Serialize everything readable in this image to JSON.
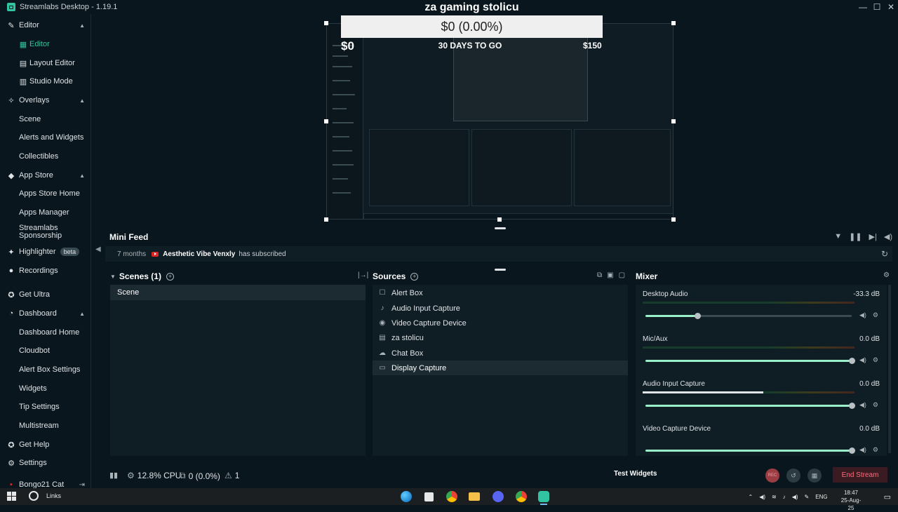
{
  "window": {
    "title": "Streamlabs Desktop - 1.19.1",
    "controls": [
      "—",
      "☐",
      "✕"
    ]
  },
  "sidebar": {
    "items": [
      {
        "label": "Editor",
        "icon": "pen-icon",
        "type": "section"
      },
      {
        "label": "Editor",
        "icon": "editor-icon",
        "type": "sub",
        "active": true
      },
      {
        "label": "Layout Editor",
        "icon": "layout-icon",
        "type": "sub"
      },
      {
        "label": "Studio Mode",
        "icon": "studio-mode-icon",
        "type": "sub"
      },
      {
        "label": "Overlays",
        "icon": "overlays-icon",
        "type": "section"
      },
      {
        "label": "Scene",
        "type": "plain"
      },
      {
        "label": "Alerts and Widgets",
        "type": "plain"
      },
      {
        "label": "Collectibles",
        "type": "plain"
      },
      {
        "label": "App Store",
        "icon": "store-icon",
        "type": "section"
      },
      {
        "label": "Apps Store Home",
        "type": "plain"
      },
      {
        "label": "Apps Manager",
        "type": "plain"
      },
      {
        "label": "Streamlabs Sponsorship",
        "type": "plain"
      },
      {
        "label": "Highlighter",
        "icon": "highlighter-icon",
        "type": "section",
        "badge": "beta"
      },
      {
        "label": "Recordings",
        "icon": "recordings-icon",
        "type": "section"
      },
      {
        "label": "Get Ultra",
        "icon": "ultra-icon",
        "type": "section"
      },
      {
        "label": "Dashboard",
        "icon": "dashboard-icon",
        "type": "section"
      },
      {
        "label": "Dashboard Home",
        "type": "plain"
      },
      {
        "label": "Cloudbot",
        "type": "plain"
      },
      {
        "label": "Alert Box Settings",
        "type": "plain"
      },
      {
        "label": "Widgets",
        "type": "plain"
      },
      {
        "label": "Tip Settings",
        "type": "plain"
      },
      {
        "label": "Multistream",
        "type": "plain"
      },
      {
        "label": "Get Help",
        "icon": "help-icon",
        "type": "section"
      },
      {
        "label": "Settings",
        "icon": "settings-icon",
        "type": "section"
      },
      {
        "label": "Bongo21 Cat",
        "icon": "bongo-icon",
        "type": "section"
      }
    ]
  },
  "preview": {
    "goal_title": "za gaming stolicu",
    "goal_progress": "$0 (0.00%)",
    "goal_start": "$0",
    "goal_days": "30 DAYS TO GO",
    "goal_target": "$150",
    "progress_fraction": 0.0
  },
  "minifeed": {
    "title": "Mini Feed",
    "event": {
      "time": "7 months",
      "platform": "youtube",
      "name": "Aesthetic Vibe Venxly",
      "action": "has subscribed"
    }
  },
  "scenes": {
    "title": "Scenes (1)",
    "items": [
      "Scene"
    ]
  },
  "sources": {
    "title": "Sources",
    "items": [
      {
        "label": "Alert Box",
        "icon": "alert-box-icon",
        "glyph": "☐"
      },
      {
        "label": "Audio Input Capture",
        "icon": "microphone-icon",
        "glyph": "♪"
      },
      {
        "label": "Video Capture Device",
        "icon": "camera-icon",
        "glyph": "◉"
      },
      {
        "label": "za stolicu",
        "icon": "goal-icon",
        "glyph": "▤"
      },
      {
        "label": "Chat Box",
        "icon": "chat-icon",
        "glyph": "☁"
      },
      {
        "label": "Display Capture",
        "icon": "monitor-icon",
        "glyph": "▭",
        "selected": true
      }
    ]
  },
  "mixer": {
    "title": "Mixer",
    "channels": [
      {
        "name": "Desktop Audio",
        "db": "-33.3 dB",
        "volume": 0.25,
        "meter": 0.0
      },
      {
        "name": "Mic/Aux",
        "db": "0.0 dB",
        "volume": 1.0,
        "meter": 0.0
      },
      {
        "name": "Audio Input Capture",
        "db": "0.0 dB",
        "volume": 1.0,
        "meter": 0.57
      },
      {
        "name": "Video Capture Device",
        "db": "0.0 dB",
        "volume": 1.0,
        "meter": 0.0
      }
    ]
  },
  "status": {
    "cpu": "12.8% CPU",
    "dropped": "0 (0.0%)",
    "alerts": "1",
    "test_widgets": "Test Widgets",
    "rec_label": "REC",
    "end_stream": "End Stream"
  },
  "taskbar": {
    "links": "Links",
    "language": "ENG",
    "time": "18:47",
    "date": "25-Aug-25"
  },
  "colors": {
    "accent": "#31c3a2",
    "background": "#09161d",
    "panel": "#0f1d24",
    "end_stream": "#ff6b7b"
  }
}
